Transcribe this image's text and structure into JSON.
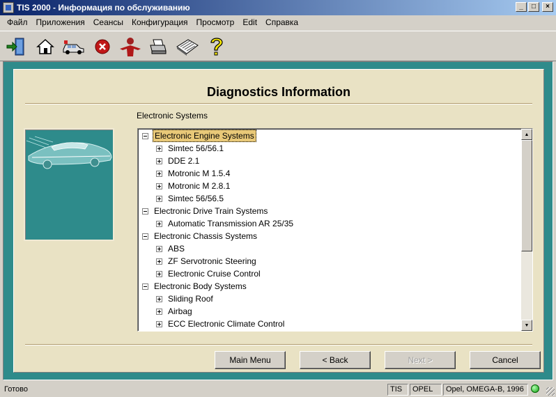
{
  "window": {
    "title": "TIS 2000 - Информация по обслуживанию"
  },
  "window_buttons": [
    "_",
    "□",
    "×"
  ],
  "menu": [
    "Файл",
    "Приложения",
    "Сеансы",
    "Конфигурация",
    "Просмотр",
    "Edit",
    "Справка"
  ],
  "toolbar": [
    "exit-icon",
    "home-icon",
    "vehicle-icon",
    "stop-icon",
    "person-icon",
    "printer-icon",
    "book-icon",
    "help-icon"
  ],
  "page": {
    "heading": "Diagnostics Information",
    "section_label": "Electronic Systems"
  },
  "tree": [
    {
      "label": "Electronic Engine Systems",
      "level": 0,
      "expanded": true,
      "selected": true
    },
    {
      "label": "Simtec 56/56.1",
      "level": 1,
      "expanded": false
    },
    {
      "label": "DDE 2.1",
      "level": 1,
      "expanded": false
    },
    {
      "label": "Motronic M 1.5.4",
      "level": 1,
      "expanded": false
    },
    {
      "label": "Motronic M 2.8.1",
      "level": 1,
      "expanded": false
    },
    {
      "label": "Simtec 56/56.5",
      "level": 1,
      "expanded": false
    },
    {
      "label": "Electronic Drive Train Systems",
      "level": 0,
      "expanded": true
    },
    {
      "label": "Automatic Transmission AR 25/35",
      "level": 1,
      "expanded": false
    },
    {
      "label": "Electronic Chassis Systems",
      "level": 0,
      "expanded": true
    },
    {
      "label": "ABS",
      "level": 1,
      "expanded": false
    },
    {
      "label": "ZF Servotronic Steering",
      "level": 1,
      "expanded": false
    },
    {
      "label": "Electronic Cruise Control",
      "level": 1,
      "expanded": false
    },
    {
      "label": "Electronic Body Systems",
      "level": 0,
      "expanded": true
    },
    {
      "label": "Sliding Roof",
      "level": 1,
      "expanded": false
    },
    {
      "label": "Airbag",
      "level": 1,
      "expanded": false
    },
    {
      "label": "ECC Electronic Climate Control",
      "level": 1,
      "expanded": false
    }
  ],
  "buttons": {
    "main_menu": "Main Menu",
    "back": "< Back",
    "next": "Next >",
    "cancel": "Cancel"
  },
  "status": {
    "text": "Готово",
    "app": "TIS",
    "make": "OPEL",
    "vehicle": "Opel, OMEGA-B, 1996"
  },
  "colors": {
    "frame": "#2e8b8b",
    "panel": "#e9e2c4",
    "selected": "#e8c878"
  }
}
